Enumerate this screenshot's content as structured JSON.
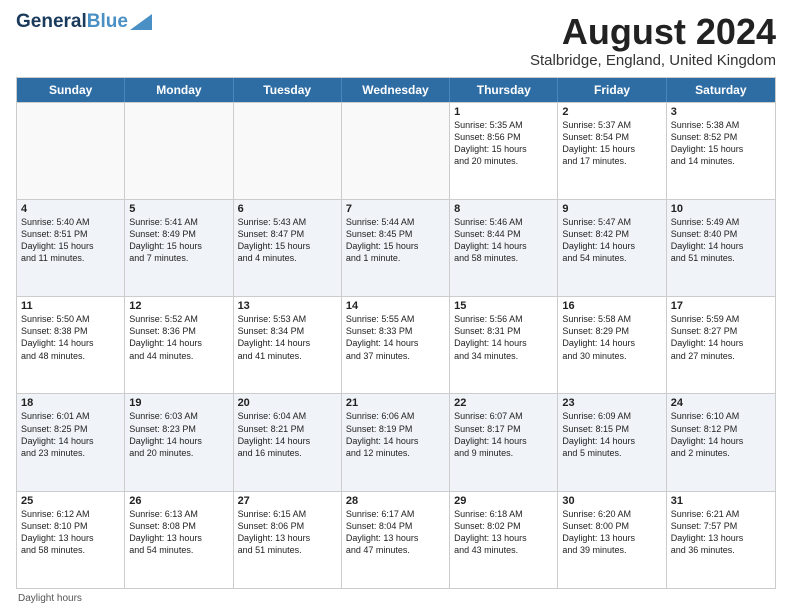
{
  "header": {
    "logo_general": "General",
    "logo_blue": "Blue",
    "month_year": "August 2024",
    "location": "Stalbridge, England, United Kingdom"
  },
  "days_of_week": [
    "Sunday",
    "Monday",
    "Tuesday",
    "Wednesday",
    "Thursday",
    "Friday",
    "Saturday"
  ],
  "footer": "Daylight hours",
  "rows": [
    [
      {
        "day": "",
        "text": ""
      },
      {
        "day": "",
        "text": ""
      },
      {
        "day": "",
        "text": ""
      },
      {
        "day": "",
        "text": ""
      },
      {
        "day": "1",
        "text": "Sunrise: 5:35 AM\nSunset: 8:56 PM\nDaylight: 15 hours\nand 20 minutes."
      },
      {
        "day": "2",
        "text": "Sunrise: 5:37 AM\nSunset: 8:54 PM\nDaylight: 15 hours\nand 17 minutes."
      },
      {
        "day": "3",
        "text": "Sunrise: 5:38 AM\nSunset: 8:52 PM\nDaylight: 15 hours\nand 14 minutes."
      }
    ],
    [
      {
        "day": "4",
        "text": "Sunrise: 5:40 AM\nSunset: 8:51 PM\nDaylight: 15 hours\nand 11 minutes."
      },
      {
        "day": "5",
        "text": "Sunrise: 5:41 AM\nSunset: 8:49 PM\nDaylight: 15 hours\nand 7 minutes."
      },
      {
        "day": "6",
        "text": "Sunrise: 5:43 AM\nSunset: 8:47 PM\nDaylight: 15 hours\nand 4 minutes."
      },
      {
        "day": "7",
        "text": "Sunrise: 5:44 AM\nSunset: 8:45 PM\nDaylight: 15 hours\nand 1 minute."
      },
      {
        "day": "8",
        "text": "Sunrise: 5:46 AM\nSunset: 8:44 PM\nDaylight: 14 hours\nand 58 minutes."
      },
      {
        "day": "9",
        "text": "Sunrise: 5:47 AM\nSunset: 8:42 PM\nDaylight: 14 hours\nand 54 minutes."
      },
      {
        "day": "10",
        "text": "Sunrise: 5:49 AM\nSunset: 8:40 PM\nDaylight: 14 hours\nand 51 minutes."
      }
    ],
    [
      {
        "day": "11",
        "text": "Sunrise: 5:50 AM\nSunset: 8:38 PM\nDaylight: 14 hours\nand 48 minutes."
      },
      {
        "day": "12",
        "text": "Sunrise: 5:52 AM\nSunset: 8:36 PM\nDaylight: 14 hours\nand 44 minutes."
      },
      {
        "day": "13",
        "text": "Sunrise: 5:53 AM\nSunset: 8:34 PM\nDaylight: 14 hours\nand 41 minutes."
      },
      {
        "day": "14",
        "text": "Sunrise: 5:55 AM\nSunset: 8:33 PM\nDaylight: 14 hours\nand 37 minutes."
      },
      {
        "day": "15",
        "text": "Sunrise: 5:56 AM\nSunset: 8:31 PM\nDaylight: 14 hours\nand 34 minutes."
      },
      {
        "day": "16",
        "text": "Sunrise: 5:58 AM\nSunset: 8:29 PM\nDaylight: 14 hours\nand 30 minutes."
      },
      {
        "day": "17",
        "text": "Sunrise: 5:59 AM\nSunset: 8:27 PM\nDaylight: 14 hours\nand 27 minutes."
      }
    ],
    [
      {
        "day": "18",
        "text": "Sunrise: 6:01 AM\nSunset: 8:25 PM\nDaylight: 14 hours\nand 23 minutes."
      },
      {
        "day": "19",
        "text": "Sunrise: 6:03 AM\nSunset: 8:23 PM\nDaylight: 14 hours\nand 20 minutes."
      },
      {
        "day": "20",
        "text": "Sunrise: 6:04 AM\nSunset: 8:21 PM\nDaylight: 14 hours\nand 16 minutes."
      },
      {
        "day": "21",
        "text": "Sunrise: 6:06 AM\nSunset: 8:19 PM\nDaylight: 14 hours\nand 12 minutes."
      },
      {
        "day": "22",
        "text": "Sunrise: 6:07 AM\nSunset: 8:17 PM\nDaylight: 14 hours\nand 9 minutes."
      },
      {
        "day": "23",
        "text": "Sunrise: 6:09 AM\nSunset: 8:15 PM\nDaylight: 14 hours\nand 5 minutes."
      },
      {
        "day": "24",
        "text": "Sunrise: 6:10 AM\nSunset: 8:12 PM\nDaylight: 14 hours\nand 2 minutes."
      }
    ],
    [
      {
        "day": "25",
        "text": "Sunrise: 6:12 AM\nSunset: 8:10 PM\nDaylight: 13 hours\nand 58 minutes."
      },
      {
        "day": "26",
        "text": "Sunrise: 6:13 AM\nSunset: 8:08 PM\nDaylight: 13 hours\nand 54 minutes."
      },
      {
        "day": "27",
        "text": "Sunrise: 6:15 AM\nSunset: 8:06 PM\nDaylight: 13 hours\nand 51 minutes."
      },
      {
        "day": "28",
        "text": "Sunrise: 6:17 AM\nSunset: 8:04 PM\nDaylight: 13 hours\nand 47 minutes."
      },
      {
        "day": "29",
        "text": "Sunrise: 6:18 AM\nSunset: 8:02 PM\nDaylight: 13 hours\nand 43 minutes."
      },
      {
        "day": "30",
        "text": "Sunrise: 6:20 AM\nSunset: 8:00 PM\nDaylight: 13 hours\nand 39 minutes."
      },
      {
        "day": "31",
        "text": "Sunrise: 6:21 AM\nSunset: 7:57 PM\nDaylight: 13 hours\nand 36 minutes."
      }
    ]
  ]
}
